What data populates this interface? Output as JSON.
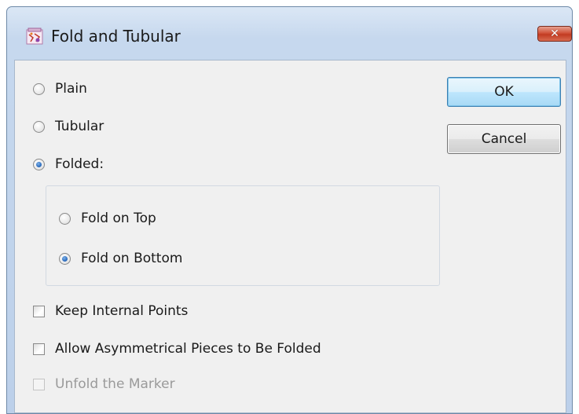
{
  "window": {
    "title": "Fold and Tubular",
    "icon": "app-icon",
    "close_icon": "close-icon",
    "close_glyph": "✕"
  },
  "options": {
    "plain": {
      "label": "Plain",
      "checked": false
    },
    "tubular": {
      "label": "Tubular",
      "checked": false
    },
    "folded": {
      "label": "Folded:",
      "checked": true
    }
  },
  "fold_group": {
    "fold_on_top": {
      "label": "Fold on Top",
      "checked": false
    },
    "fold_on_bottom": {
      "label": "Fold on Bottom",
      "checked": true
    }
  },
  "checkboxes": {
    "keep_internal_points": {
      "label": "Keep Internal Points",
      "checked": false,
      "enabled": true
    },
    "allow_asymmetrical": {
      "label": "Allow Asymmetrical Pieces to Be Folded",
      "checked": false,
      "enabled": true
    },
    "unfold_marker": {
      "label": "Unfold the Marker",
      "checked": false,
      "enabled": false
    }
  },
  "buttons": {
    "ok": "OK",
    "cancel": "Cancel"
  },
  "colors": {
    "titlebar": "#c6d8ee",
    "client_bg": "#f0f0f0",
    "close_button": "#c23b22",
    "ok_button": "#bee6fd",
    "radio_selected": "#2f6fc0"
  }
}
